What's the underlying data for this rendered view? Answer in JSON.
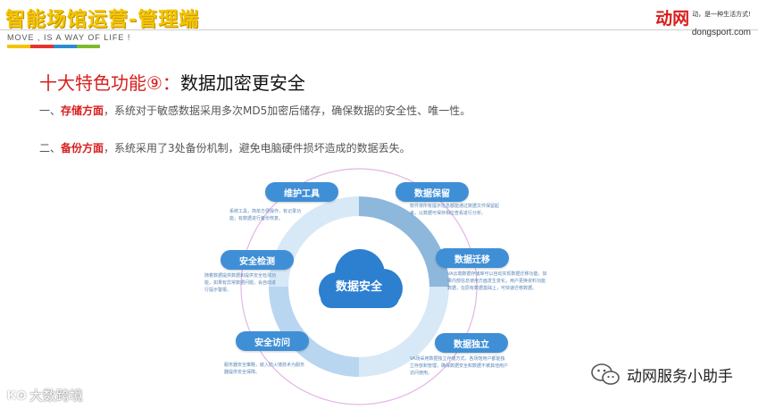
{
  "header": {
    "title": "智能场馆运营-管理端",
    "tagline": "MOVE , IS A WAY OF LIFE !",
    "strip_colors": [
      "#f5c400",
      "#e8322f",
      "#2a8dd4",
      "#7dbb2a"
    ]
  },
  "brand": {
    "logo": "动网",
    "slogan": "动，是一种生活方式!",
    "domain": "dongsport.com"
  },
  "section": {
    "title_prefix": "十大特色功能⑨：",
    "title_main": "数据加密更安全"
  },
  "paragraphs": [
    {
      "prefix": "一、",
      "highlight": "存储方面",
      "text": "，系统对于敏感数据采用多次MD5加密后储存，确保数据的安全性、唯一性。"
    },
    {
      "prefix": "二、",
      "highlight": "备份方面",
      "text": "，系统采用了3处备份机制，避免电脑硬件损坏造成的数据丢失。"
    }
  ],
  "diagram": {
    "center": "数据安全",
    "nodes": [
      {
        "label": "维护工具",
        "desc": "系统工具，简单方便操作，有记录功能，有数据进行备份恢复。"
      },
      {
        "label": "数据保留",
        "desc": "软件将所有提示信息都能通过数据文件保留起来，以数据可保存相应查看进行分析。"
      },
      {
        "label": "安全检测",
        "desc": "随着数据提供数据和提供安全检测功能，如果有异常数据问题，会自动进行提示警报。"
      },
      {
        "label": "数据迁移",
        "desc": "VA云端数据存储库可以自动实现数据迁移功能。如果内部信息使用方面发生变化，用户更换资料功能数据，在原有数据基础上，可快速迁移数据。"
      },
      {
        "label": "安全访问",
        "desc": "服务器安全策略，嵌入防火墙技术为服务器提供安全保障。"
      },
      {
        "label": "数据独立",
        "desc": "VA场采用数据独立存储方式，各场馆用户都能独立存放和管理，确保数据安全和数据不被其他用户访问使用。"
      }
    ],
    "colors": {
      "pill": "#3f8fd6",
      "cloud": "#2d7fcf",
      "ring": "#b9d6f0",
      "ring_accent": "#8eb7dc",
      "orbit": "#e3b6e6"
    }
  },
  "wechat": {
    "name": "动网服务小助手"
  },
  "watermark": {
    "logo": "K⊙",
    "text": "大数跨境"
  }
}
